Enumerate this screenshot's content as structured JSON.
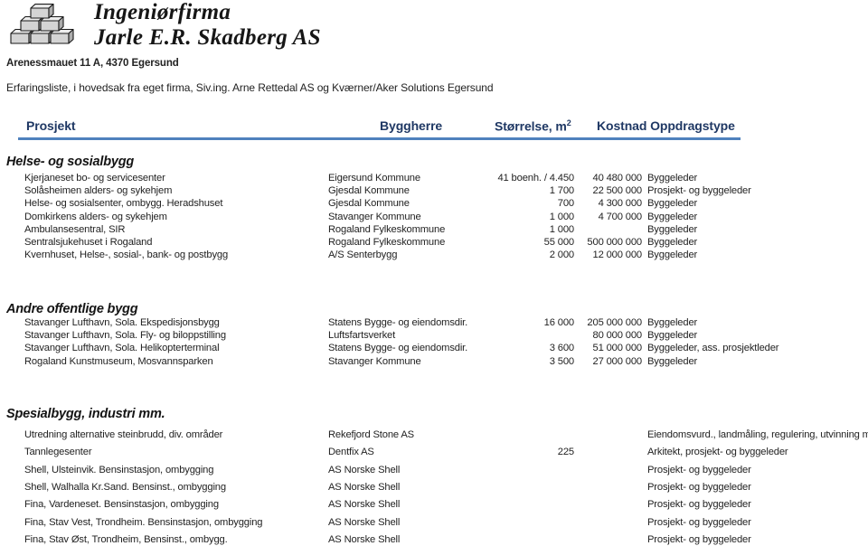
{
  "letterhead": {
    "logo_icon": "brick-stack-logo",
    "company_line1": "Ingeniørfirma",
    "company_line2": "Jarle E.R. Skadberg AS",
    "address": "Arenessmauet 11 A, 4370 Egersund",
    "intro": "Erfaringsliste, i hovedsak fra eget firma, Siv.ing. Arne Rettedal AS og Kværner/Aker Solutions Egersund"
  },
  "colors": {
    "header_text": "#1f3864",
    "header_rule": "#4f81bd",
    "body_text": "#222222",
    "logo_fill": "#c9c9c9",
    "logo_stroke": "#1a1a1a"
  },
  "table": {
    "headers": {
      "prosjekt": "Prosjekt",
      "byggherre": "Byggherre",
      "storrelse": "Størrelse, m",
      "storrelse_sup": "2",
      "kostnad": "Kostnad Oppdragstype"
    },
    "sections": [
      {
        "title": "Helse- og sosialbygg",
        "rows": [
          {
            "prosjekt": "Kjerjaneset bo- og servicesenter",
            "byggherre": "Eigersund Kommune",
            "storrelse": "41 boenh. / 4.450",
            "kostnad": "40 480 000",
            "type": "Byggeleder"
          },
          {
            "prosjekt": "Solåsheimen alders- og sykehjem",
            "byggherre": "Gjesdal Kommune",
            "storrelse": "1 700",
            "kostnad": "22 500 000",
            "type": "Prosjekt- og byggeleder"
          },
          {
            "prosjekt": "Helse- og sosialsenter, ombygg. Heradshuset",
            "byggherre": "Gjesdal Kommune",
            "storrelse": "700",
            "kostnad": "4 300 000",
            "type": "Byggeleder"
          },
          {
            "prosjekt": "Domkirkens alders- og sykehjem",
            "byggherre": "Stavanger Kommune",
            "storrelse": "1 000",
            "kostnad": "4 700 000",
            "type": "Byggeleder"
          },
          {
            "prosjekt": "Ambulansesentral, SIR",
            "byggherre": "Rogaland Fylkeskommune",
            "storrelse": "1 000",
            "kostnad": "",
            "type": "Byggeleder"
          },
          {
            "prosjekt": "Sentralsjukehuset i Rogaland",
            "byggherre": "Rogaland Fylkeskommune",
            "storrelse": "55 000",
            "kostnad": "500 000 000",
            "type": "Byggeleder"
          },
          {
            "prosjekt": "Kvernhuset, Helse-, sosial-, bank- og postbygg",
            "byggherre": "A/S Senterbygg",
            "storrelse": "2 000",
            "kostnad": "12 000 000",
            "type": "Byggeleder"
          }
        ]
      },
      {
        "title": "Andre offentlige bygg",
        "rows": [
          {
            "prosjekt": "Stavanger Lufthavn, Sola. Ekspedisjonsbygg",
            "byggherre": "Statens Bygge- og eiendomsdir.",
            "storrelse": "16 000",
            "kostnad": "205 000 000",
            "type": "Byggeleder"
          },
          {
            "prosjekt": "Stavanger Lufthavn, Sola. Fly- og biloppstilling",
            "byggherre": "Luftsfartsverket",
            "storrelse": "",
            "kostnad": "80 000 000",
            "type": "Byggeleder"
          },
          {
            "prosjekt": "Stavanger Lufthavn, Sola. Helikopterterminal",
            "byggherre": "Statens Bygge- og eiendomsdir.",
            "storrelse": "3 600",
            "kostnad": "51 000 000",
            "type": "Byggeleder, ass. prosjektleder"
          },
          {
            "prosjekt": "Rogaland Kunstmuseum, Mosvannsparken",
            "byggherre": "Stavanger Kommune",
            "storrelse": "3 500",
            "kostnad": "27 000 000",
            "type": "Byggeleder"
          }
        ]
      },
      {
        "title": "Spesialbygg, industri mm.",
        "rows": [
          {
            "prosjekt": "Utredning alternative steinbrudd, div. områder",
            "byggherre": "Rekefjord Stone AS",
            "storrelse": "",
            "kostnad": "",
            "type": "Eiendomsvurd., landmåling, regulering, utvinning mm."
          },
          {
            "prosjekt": "Tannlegesenter",
            "byggherre": "Dentfix AS",
            "storrelse": "225",
            "kostnad": "",
            "type": "Arkitekt, prosjekt- og byggeleder"
          },
          {
            "prosjekt": "Shell, Ulsteinvik. Bensinstasjon, ombygging",
            "byggherre": "AS Norske Shell",
            "storrelse": "",
            "kostnad": "",
            "type": "Prosjekt- og byggeleder"
          },
          {
            "prosjekt": "Shell, Walhalla Kr.Sand. Bensinst., ombygging",
            "byggherre": "AS Norske Shell",
            "storrelse": "",
            "kostnad": "",
            "type": "Prosjekt- og byggeleder"
          },
          {
            "prosjekt": "Fina, Vardeneset. Bensinstasjon, ombygging",
            "byggherre": "AS Norske Shell",
            "storrelse": "",
            "kostnad": "",
            "type": "Prosjekt- og byggeleder"
          },
          {
            "prosjekt": "Fina, Stav Vest, Trondheim. Bensinstasjon, ombygging",
            "byggherre": "AS Norske Shell",
            "storrelse": "",
            "kostnad": "",
            "type": "Prosjekt- og byggeleder"
          },
          {
            "prosjekt": "Fina, Stav Øst, Trondheim, Bensinst., ombygg.",
            "byggherre": "AS Norske Shell",
            "storrelse": "",
            "kostnad": "",
            "type": "Prosjekt- og byggeleder"
          }
        ]
      }
    ]
  },
  "layout": {
    "section_tops": [
      171,
      334,
      450
    ],
    "section_first_row_tops": [
      190,
      350,
      474
    ],
    "section_row_steps": [
      14.2,
      14.2,
      19.3
    ]
  }
}
